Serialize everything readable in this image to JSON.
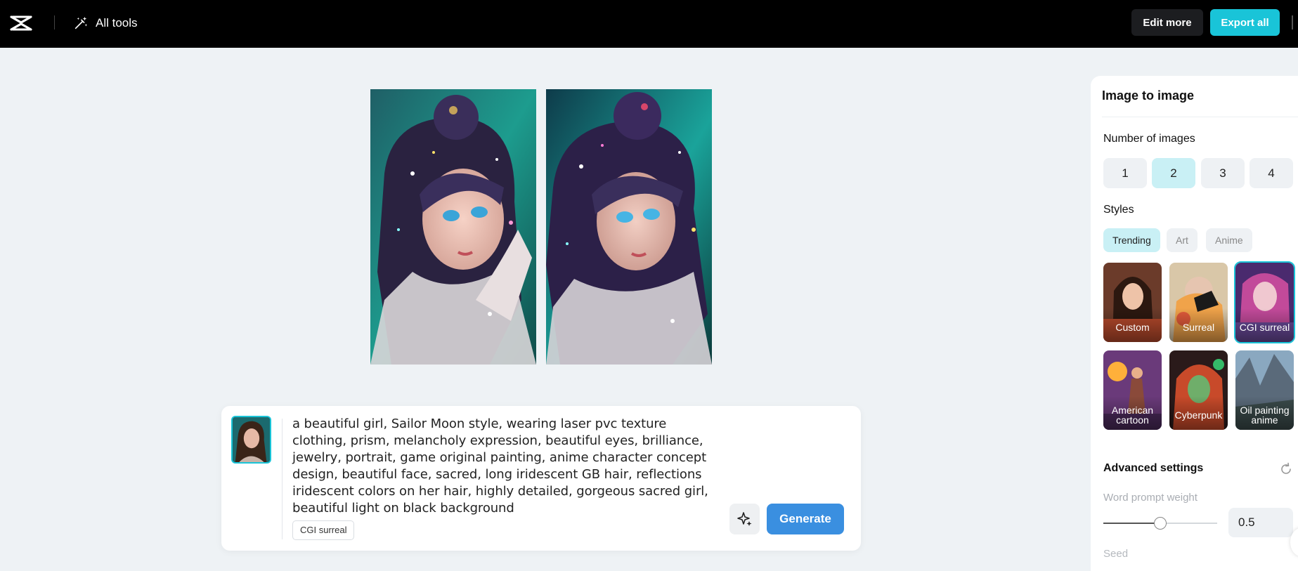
{
  "topbar": {
    "all_tools_label": "All tools",
    "edit_more_label": "Edit more",
    "export_all_label": "Export all"
  },
  "prompt": {
    "text": "a beautiful girl, Sailor Moon style, wearing laser pvc texture clothing, prism, melancholy expression, beautiful eyes, brilliance, jewelry, portrait, game original painting, anime character concept design, beautiful face, sacred, long iridescent GB hair, reflections iridescent colors on her hair, highly detailed, gorgeous sacred girl, beautiful light on black background",
    "style_chip": "CGI surreal",
    "generate_label": "Generate"
  },
  "panel": {
    "title": "Image to image",
    "num_images_label": "Number of images",
    "num_options": [
      "1",
      "2",
      "3",
      "4"
    ],
    "num_selected": "2",
    "styles_label": "Styles",
    "style_tabs": [
      "Trending",
      "Art",
      "Anime"
    ],
    "style_tab_selected": "Trending",
    "style_cards": [
      "Custom",
      "Surreal",
      "CGI surreal",
      "American cartoon",
      "Cyberpunk",
      "Oil painting anime"
    ],
    "style_card_selected": "CGI surreal",
    "advanced_label": "Advanced settings",
    "word_prompt_weight_label": "Word prompt weight",
    "word_prompt_weight_value": "0.5",
    "seed_label": "Seed"
  },
  "colors": {
    "accent": "#19c4d8",
    "generate": "#3a8fe0",
    "topbar": "#000000",
    "canvas": "#eef2f5"
  }
}
